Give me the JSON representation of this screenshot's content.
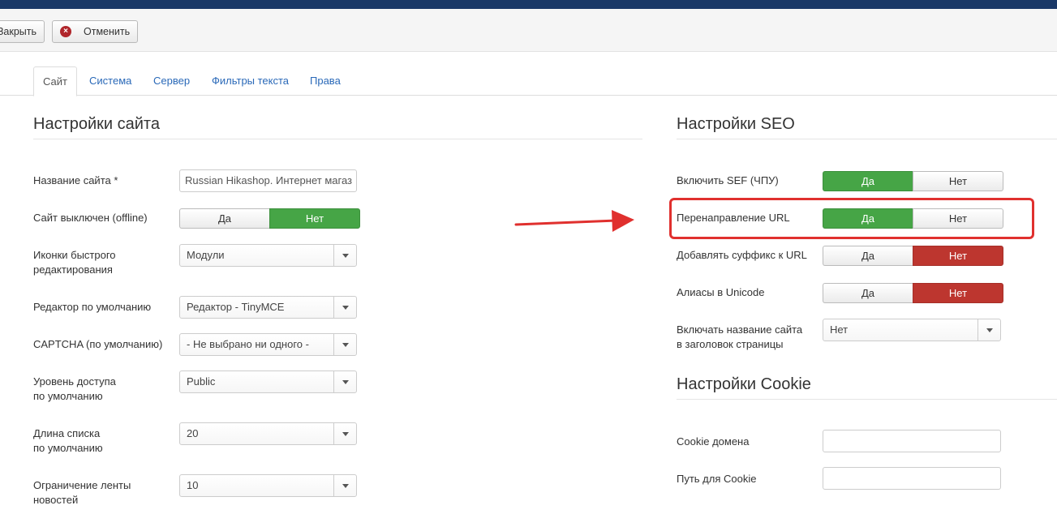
{
  "toolbar": {
    "close_label": "Закрыть",
    "cancel_label": "Отменить"
  },
  "tabs": [
    {
      "label": "Сайт",
      "active": true
    },
    {
      "label": "Система"
    },
    {
      "label": "Сервер"
    },
    {
      "label": "Фильтры текста"
    },
    {
      "label": "Права"
    }
  ],
  "site": {
    "title": "Настройки сайта",
    "site_name": {
      "label": "Название сайта *",
      "value": "Russian Hikashop. Интернет магаз"
    },
    "offline": {
      "label": "Сайт выключен (offline)",
      "yes": "Да",
      "no": "Нет",
      "selected": "no"
    },
    "quick_icons": {
      "label_line1": "Иконки быстрого",
      "label_line2": "редактирования",
      "value": "Модули"
    },
    "editor": {
      "label": "Редактор по умолчанию",
      "value": "Редактор - TinyMCE"
    },
    "captcha": {
      "label": "CAPTCHA (по умолчанию)",
      "value": "- Не выбрано ни одного -"
    },
    "access": {
      "label_line1": "Уровень доступа",
      "label_line2": "по умолчанию",
      "value": "Public"
    },
    "list_length": {
      "label_line1": "Длина списка",
      "label_line2": "по умолчанию",
      "value": "20"
    },
    "feed_limit": {
      "label_line1": "Ограничение ленты",
      "label_line2": "новостей",
      "value": "10"
    }
  },
  "seo": {
    "title": "Настройки SEO",
    "sef": {
      "label": "Включить SEF (ЧПУ)",
      "yes": "Да",
      "no": "Нет",
      "selected": "yes"
    },
    "rewrite": {
      "label": "Перенаправление URL",
      "yes": "Да",
      "no": "Нет",
      "selected": "yes"
    },
    "suffix": {
      "label": "Добавлять суффикс к URL",
      "yes": "Да",
      "no": "Нет",
      "selected": "no"
    },
    "unicode": {
      "label": "Алиасы в Unicode",
      "yes": "Да",
      "no": "Нет",
      "selected": "no"
    },
    "sitename_in_title": {
      "label_line1": "Включать название сайта",
      "label_line2": "в заголовок страницы",
      "value": "Нет"
    }
  },
  "cookie": {
    "title": "Настройки Cookie",
    "domain": {
      "label": "Cookie домена",
      "value": ""
    },
    "path": {
      "label": "Путь для Cookie",
      "value": ""
    }
  },
  "colors": {
    "header_bar": "#1a3867",
    "toggle_green": "#46a546",
    "toggle_red": "#bd362f",
    "annotation_red": "#e0302e",
    "link_blue": "#2a69b8"
  }
}
